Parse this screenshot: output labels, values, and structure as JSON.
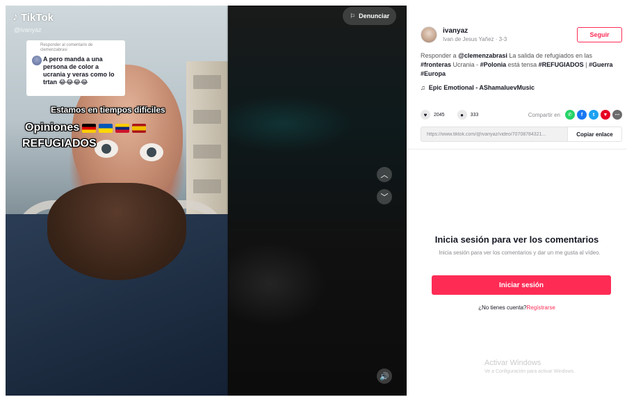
{
  "video": {
    "brand": "TikTok",
    "username_overlay": "@ivanyaz",
    "reply_card": {
      "header": "Responder al comentario de",
      "handle": "clemenzabrasi",
      "message": "A pero manda a una persona de color a ucrania y veras como lo trtan 😂😂😂😂"
    },
    "overlay": {
      "line1": "Estamos en tiempos difíciles",
      "line2": "Opiniones",
      "line3": "REFUGIADOS"
    },
    "report_label": "Denunciar"
  },
  "panel": {
    "author": {
      "username": "ivanyaz",
      "subtitle": "Ivan de Jesus Yañez · 3-3"
    },
    "follow_label": "Seguir",
    "description": {
      "prefix": "Responder a",
      "mention": "@clemenzabrasi",
      "text1": "La salida de refugiados en las",
      "tag1": "#fronteras",
      "text2": "Ucrania -",
      "tag2": "#Polonia",
      "text3": "está tensa",
      "tag3": "#REFUGIADOS",
      "sep": "|",
      "tag4": "#Guerra",
      "tag5": "#Europa"
    },
    "music": "Epic Emotional - AShamaluevMusic",
    "stats": {
      "likes": "2045",
      "comments": "333",
      "share_label": "Compartir en"
    },
    "link": {
      "url": "https://www.tiktok.com/@ivanyaz/video/70708784321...",
      "copy_label": "Copiar enlace"
    },
    "login": {
      "title": "Inicia sesión para ver los comentarios",
      "subtitle": "Inicia sesión para ver los comentarios y dar un me gusta al vídeo.",
      "button": "Iniciar sesión",
      "no_account": "¿No tienes cuenta?",
      "signup": "Regístrarse"
    },
    "watermark": {
      "title": "Activar Windows",
      "subtitle": "Ve a Configuración para activar Windows."
    }
  },
  "colors": {
    "accent": "#fe2c55",
    "whatsapp": "#25d366",
    "facebook": "#1877f2",
    "twitter": "#1da1f2",
    "pinterest": "#e60023",
    "more": "#6b6b6b"
  }
}
